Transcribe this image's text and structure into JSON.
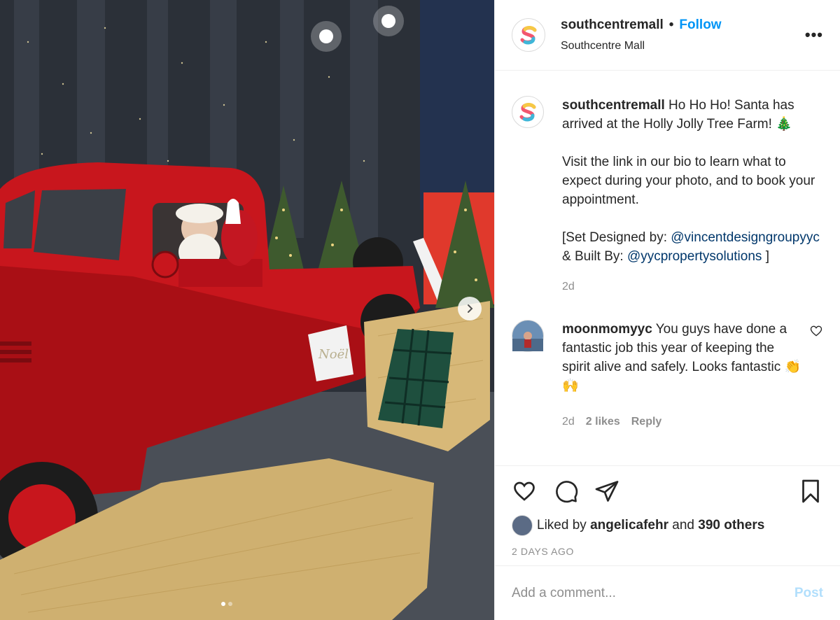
{
  "header": {
    "username": "southcentremall",
    "separator": "•",
    "follow_label": "Follow",
    "location": "Southcentre Mall",
    "more_label": "•••"
  },
  "caption": {
    "username": "southcentremall",
    "line1": "Ho Ho Ho! Santa has arrived at the Holly Jolly Tree Farm! 🎄",
    "line2": "Visit the link in our bio to learn what to expect during your photo, and to book your appointment.",
    "line3_prefix": "[Set Designed by:",
    "mention1": "@vincentdesigngroupyyc",
    "line3_middle": "& Built By:",
    "mention2": "@yycpropertysolutions",
    "line3_suffix": "]",
    "age": "2d"
  },
  "comment": {
    "username": "moonmomyyc",
    "text": "You guys have done a fantastic job this year of keeping the spirit alive and safely. Looks fantastic 👏🙌",
    "age": "2d",
    "likes": "2 likes",
    "reply_label": "Reply"
  },
  "likes": {
    "prefix": "Liked by",
    "user": "angelicafehr",
    "middle": "and",
    "others": "390 others"
  },
  "post_date": "2 DAYS AGO",
  "add_comment": {
    "placeholder": "Add a comment...",
    "post_label": "Post"
  },
  "carousel": {
    "current": 1,
    "total": 2
  },
  "colors": {
    "accent": "#0095f6",
    "link": "#00376b",
    "muted": "#8e8e8e",
    "post_disabled": "#b2dffc"
  },
  "icons": [
    "heart-icon",
    "comment-icon",
    "share-icon",
    "bookmark-icon",
    "more-icon",
    "chevron-right-icon"
  ]
}
